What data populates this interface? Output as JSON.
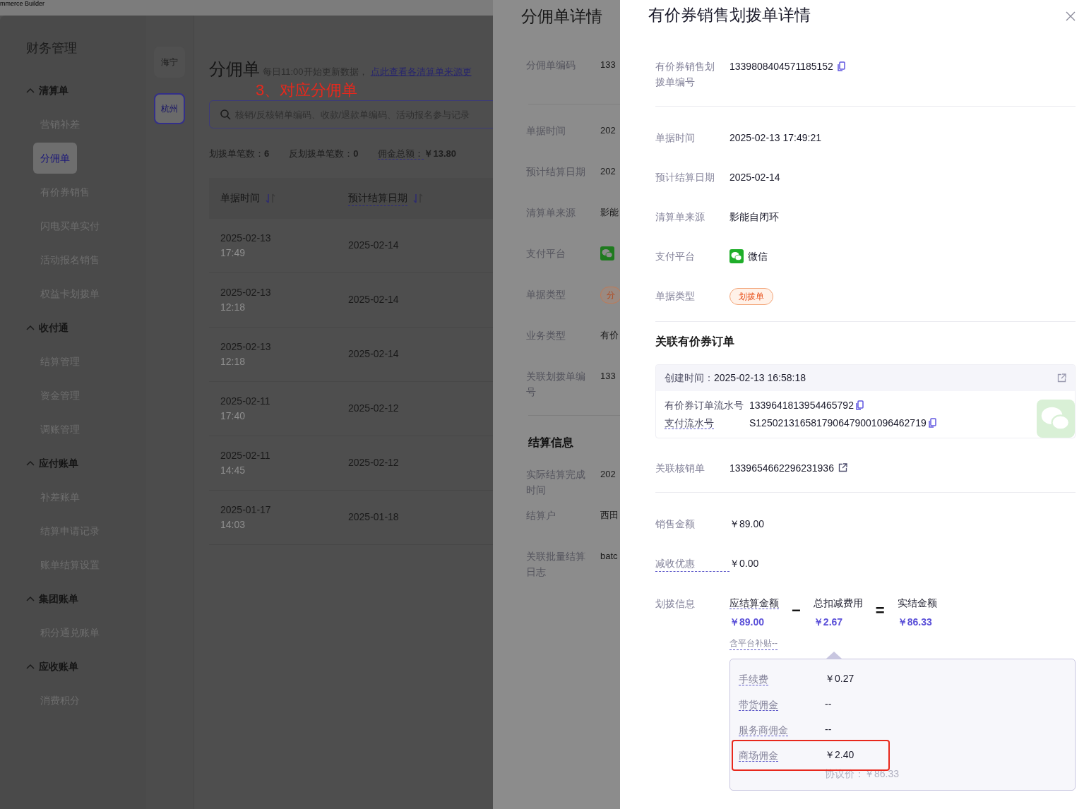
{
  "window": {
    "title": "mmerce Builder"
  },
  "sidebar": {
    "title": "财务管理",
    "groups": [
      {
        "label": "清算单",
        "expanded": true,
        "items": [
          {
            "label": "营销补差",
            "selected": false
          },
          {
            "label": "分佣单",
            "selected": true
          },
          {
            "label": "有价券销售",
            "selected": false
          },
          {
            "label": "闪电买单实付",
            "selected": false
          },
          {
            "label": "活动报名销售",
            "selected": false
          },
          {
            "label": "权益卡划拨单",
            "selected": false
          }
        ]
      },
      {
        "label": "收付通",
        "expanded": true,
        "items": [
          {
            "label": "结算管理",
            "selected": false
          },
          {
            "label": "资金管理",
            "selected": false
          },
          {
            "label": "调账管理",
            "selected": false
          }
        ]
      },
      {
        "label": "应付账单",
        "expanded": true,
        "items": [
          {
            "label": "补差账单",
            "selected": false
          },
          {
            "label": "结算申请记录",
            "selected": false
          },
          {
            "label": "账单结算设置",
            "selected": false
          }
        ]
      },
      {
        "label": "集团账单",
        "expanded": true,
        "items": [
          {
            "label": "积分通兑账单",
            "selected": false
          }
        ]
      },
      {
        "label": "应收账单",
        "expanded": true,
        "items": [
          {
            "label": "消费积分",
            "selected": false
          }
        ]
      }
    ]
  },
  "stores": [
    {
      "label": "海宁",
      "selected": false
    },
    {
      "label": "杭州",
      "selected": true
    }
  ],
  "page": {
    "title": "分佣单",
    "note": "每日11:00开始更新数据，",
    "link": "点此查看各清算单来源更",
    "search": {
      "placeholder": "核销/反核销单编码、收款/退款单编码、活动报名参与记录"
    },
    "annotation": "3、对应分佣单",
    "stats": [
      {
        "label": "划拨单笔数：",
        "value": "6",
        "tip": false
      },
      {
        "label": "反划拨单笔数：",
        "value": "0",
        "tip": false
      },
      {
        "label": "佣金总额：",
        "value": "￥13.80",
        "tip": true
      }
    ]
  },
  "table": {
    "columns": [
      {
        "label": "单据时间",
        "tip": false
      },
      {
        "label": "预计结算日期",
        "tip": true
      }
    ],
    "rows": [
      {
        "date": "2025-02-13",
        "time": "17:49",
        "settle": "2025-02-14"
      },
      {
        "date": "2025-02-13",
        "time": "12:18",
        "settle": "2025-02-14"
      },
      {
        "date": "2025-02-13",
        "time": "12:18",
        "settle": "2025-02-14"
      },
      {
        "date": "2025-02-11",
        "time": "17:40",
        "settle": "2025-02-12"
      },
      {
        "date": "2025-02-11",
        "time": "14:45",
        "settle": "2025-02-12"
      },
      {
        "date": "2025-01-17",
        "time": "14:03",
        "settle": "2025-01-18"
      }
    ]
  },
  "commission_drawer": {
    "title": "分佣单详情",
    "sections": [
      {
        "fields": [
          {
            "kind": "text",
            "label": "分佣单编码",
            "value": "133"
          }
        ]
      },
      {
        "fields": [
          {
            "kind": "text",
            "label": "单据时间",
            "value": "202"
          },
          {
            "kind": "text",
            "label": "预计结算日期",
            "value": "202"
          },
          {
            "kind": "text",
            "label": "清算单来源",
            "value": "影能"
          },
          {
            "kind": "platform",
            "label": "支付平台"
          },
          {
            "kind": "tag",
            "label": "单据类型",
            "value": "分"
          },
          {
            "kind": "text",
            "label": "业务类型",
            "value": "有价"
          },
          {
            "kind": "text",
            "label": "关联划拨单编号",
            "value": "133"
          }
        ]
      },
      {
        "title": "结算信息",
        "fields": [
          {
            "kind": "text",
            "label": "实际结算完成时间",
            "value": "202"
          },
          {
            "kind": "text",
            "label": "结算户",
            "value": "西田"
          },
          {
            "kind": "text",
            "label": "关联批量结算日志",
            "value": "batc"
          }
        ]
      }
    ]
  },
  "allocation_drawer": {
    "title": "有价券销售划拨单详情",
    "sections": [
      {
        "fields": [
          {
            "kind": "copy",
            "label": "有价券销售划拨单编号",
            "value": "1339808404571185152",
            "tip": false
          }
        ]
      },
      {
        "fields": [
          {
            "kind": "text",
            "label": "单据时间",
            "value": "2025-02-13 17:49:21",
            "tip": false
          },
          {
            "kind": "text",
            "label": "预计结算日期",
            "value": "2025-02-14",
            "tip": false
          },
          {
            "kind": "text",
            "label": "清算单来源",
            "value": "影能自闭环",
            "tip": false
          },
          {
            "kind": "platform",
            "label": "支付平台",
            "value": "微信",
            "tip": false
          },
          {
            "kind": "tag",
            "label": "单据类型",
            "value": "划拨单",
            "tip": false
          }
        ]
      },
      {
        "title": "关联有价券订单",
        "order_card": {
          "created_label": "创建时间：",
          "created": "2025-02-13 16:58:18",
          "rows": [
            {
              "label": "有价券订单流水号",
              "value": "1339641813954465792",
              "tip": false
            },
            {
              "label": "支付流水号",
              "value": "S1250213165817906479001096462719",
              "tip": true
            }
          ]
        },
        "fields": [
          {
            "kind": "link",
            "label": "关联核销单",
            "value": "1339654662296231936",
            "tip": false
          }
        ]
      },
      {
        "fields": [
          {
            "kind": "text",
            "label": "销售金额",
            "value": "￥89.00",
            "tip": false
          },
          {
            "kind": "text",
            "label": "减收优惠",
            "value": "￥0.00",
            "tip": true
          }
        ],
        "allocation": {
          "label": "划拨信息",
          "terms": [
            {
              "label": "应结算金额",
              "value": "￥89.00",
              "tip": true
            },
            {
              "label": "总扣减费用",
              "value": "￥2.67",
              "tip": false
            },
            {
              "label": "实结金额",
              "value": "￥86.33",
              "tip": false
            }
          ],
          "operators": [
            "−",
            "="
          ],
          "subsidy": "含平台补贴--",
          "breakdown": [
            {
              "label": "手续费",
              "value": "￥0.27",
              "highlighted": false
            },
            {
              "label": "带货佣金",
              "value": "--",
              "highlighted": false
            },
            {
              "label": "服务商佣金",
              "value": "--",
              "highlighted": false
            },
            {
              "label": "商场佣金",
              "value": "￥2.40",
              "highlighted": true
            }
          ],
          "agreement": "协议价：￥86.33"
        }
      }
    ]
  }
}
